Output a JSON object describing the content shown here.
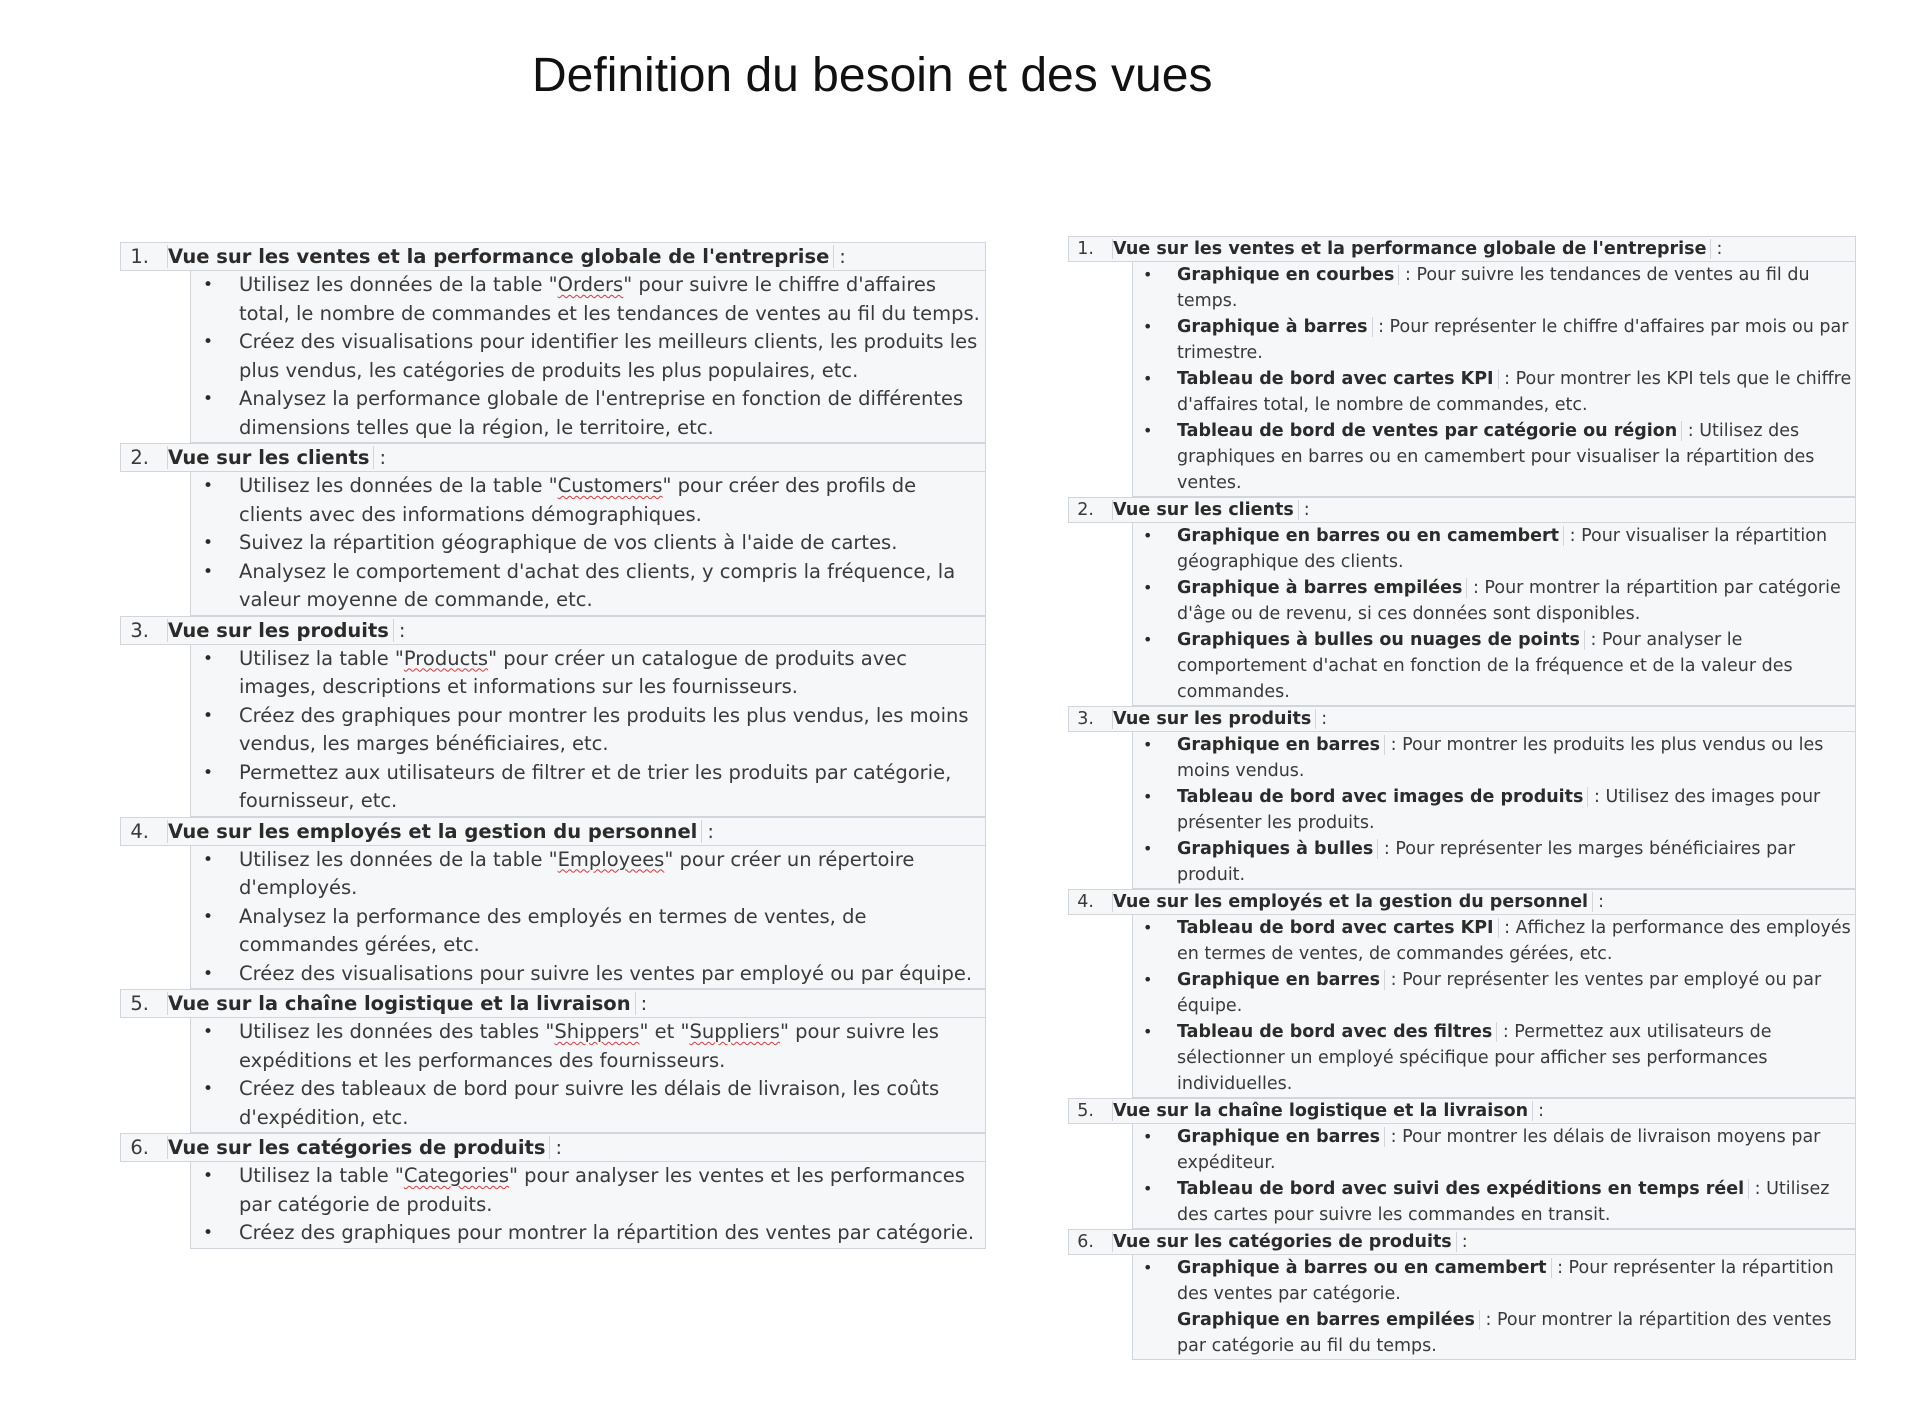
{
  "title": "Definition du besoin et des vues",
  "left": {
    "sections": [
      {
        "num": "1.",
        "title": "Vue sur les ventes et la performance globale de l'entreprise",
        "items": [
          {
            "pre": "Utilisez les données de la table \"",
            "table": "Orders",
            "post": "\" pour suivre le chiffre d'affaires total, le nombre de commandes et les tendances de ventes au fil du temps."
          },
          {
            "pre": "Créez des visualisations pour identifier les meilleurs clients, les produits les plus vendus, les catégories de produits les plus populaires, etc."
          },
          {
            "pre": "Analysez la performance globale de l'entreprise en fonction de différentes dimensions telles que la région, le territoire, etc."
          }
        ]
      },
      {
        "num": "2.",
        "title": "Vue sur les clients",
        "items": [
          {
            "pre": "Utilisez les données de la table \"",
            "table": "Customers",
            "post": "\" pour créer des profils de clients avec des informations démographiques."
          },
          {
            "pre": "Suivez la répartition géographique de vos clients à l'aide de cartes."
          },
          {
            "pre": "Analysez le comportement d'achat des clients, y compris la fréquence, la valeur moyenne de commande, etc."
          }
        ]
      },
      {
        "num": "3.",
        "title": "Vue sur les produits",
        "items": [
          {
            "pre": "Utilisez la table \"",
            "table": "Products",
            "post": "\" pour créer un catalogue de produits avec images, descriptions et informations sur les fournisseurs."
          },
          {
            "pre": "Créez des graphiques pour montrer les produits les plus vendus, les moins vendus, les marges bénéficiaires, etc."
          },
          {
            "pre": "Permettez aux utilisateurs de filtrer et de trier les produits par catégorie, fournisseur, etc."
          }
        ]
      },
      {
        "num": "4.",
        "title": "Vue sur les employés et la gestion du personnel",
        "items": [
          {
            "pre": "Utilisez les données de la table \"",
            "table": "Employees",
            "post": "\" pour créer un répertoire d'employés."
          },
          {
            "pre": "Analysez la performance des employés en termes de ventes, de commandes gérées, etc."
          },
          {
            "pre": "Créez des visualisations pour suivre les ventes par employé ou par équipe."
          }
        ]
      },
      {
        "num": "5.",
        "title": "Vue sur la chaîne logistique et la livraison",
        "items": [
          {
            "pre": "Utilisez les données des tables \"",
            "table": "Shippers",
            "mid": "\" et \"",
            "table2": "Suppliers",
            "post": "\" pour suivre les expéditions et les performances des fournisseurs."
          },
          {
            "pre": "Créez des tableaux de bord pour suivre les délais de livraison, les coûts d'expédition, etc."
          }
        ]
      },
      {
        "num": "6.",
        "title": "Vue sur les catégories de produits",
        "items": [
          {
            "pre": "Utilisez la table \"",
            "table": "Categories",
            "post": "\" pour analyser les ventes et les performances par catégorie de produits."
          },
          {
            "pre": "Créez des graphiques pour montrer la répartition des ventes par catégorie."
          }
        ]
      }
    ]
  },
  "right": {
    "sections": [
      {
        "num": "1.",
        "title": "Vue sur les ventes et la performance globale de l'entreprise",
        "items": [
          {
            "bold": "Graphique en courbes",
            "text": " : Pour suivre les tendances de ventes au fil du temps."
          },
          {
            "bold": "Graphique à barres",
            "text": " : Pour représenter le chiffre d'affaires par mois ou par trimestre."
          },
          {
            "bold": "Tableau de bord avec cartes KPI",
            "text": " : Pour montrer les KPI tels que le chiffre d'affaires total, le nombre de commandes, etc."
          },
          {
            "bold": "Tableau de bord de ventes par catégorie ou région",
            "text": " : Utilisez des graphiques en barres ou en camembert pour visualiser la répartition des ventes."
          }
        ]
      },
      {
        "num": "2.",
        "title": "Vue sur les clients",
        "items": [
          {
            "bold": "Graphique en barres ou en camembert",
            "text": " : Pour visualiser la répartition géographique des clients."
          },
          {
            "bold": "Graphique à barres empilées",
            "text": " : Pour montrer la répartition par catégorie d'âge ou de revenu, si ces données sont disponibles."
          },
          {
            "bold": "Graphiques à bulles ou nuages de points",
            "text": " : Pour analyser le comportement d'achat en fonction de la fréquence et de la valeur des commandes."
          }
        ]
      },
      {
        "num": "3.",
        "title": "Vue sur les produits",
        "items": [
          {
            "bold": "Graphique en barres",
            "text": " : Pour montrer les produits les plus vendus ou les moins vendus."
          },
          {
            "bold": "Tableau de bord avec images de produits",
            "text": " : Utilisez des images pour présenter les produits."
          },
          {
            "bold": "Graphiques à bulles",
            "text": " : Pour représenter les marges bénéficiaires par produit."
          }
        ]
      },
      {
        "num": "4.",
        "title": "Vue sur les employés et la gestion du personnel",
        "items": [
          {
            "bold": "Tableau de bord avec cartes KPI",
            "text": " : Affichez la performance des employés en termes de ventes, de commandes gérées, etc."
          },
          {
            "bold": "Graphique en barres",
            "text": " : Pour représenter les ventes par employé ou par équipe."
          },
          {
            "bold": "Tableau de bord avec des filtres",
            "text": " : Permettez aux utilisateurs de sélectionner un employé spécifique pour afficher ses performances individuelles."
          }
        ]
      },
      {
        "num": "5.",
        "title": "Vue sur la chaîne logistique et la livraison",
        "items": [
          {
            "bold": "Graphique en barres",
            "text": " : Pour montrer les délais de livraison moyens par expéditeur."
          },
          {
            "bold": "Tableau de bord avec suivi des expéditions en temps réel",
            "text": " : Utilisez des cartes pour suivre les commandes en transit."
          }
        ]
      },
      {
        "num": "6.",
        "title": "Vue sur les catégories de produits",
        "items": [
          {
            "bold": "Graphique à barres ou en camembert",
            "text": " : Pour représenter la répartition des ventes par catégorie."
          },
          {
            "bold": "Graphique en barres empilées",
            "text": " : Pour montrer la répartition des ventes par catégorie au fil du temps.",
            "nobullet": true
          }
        ]
      }
    ]
  }
}
